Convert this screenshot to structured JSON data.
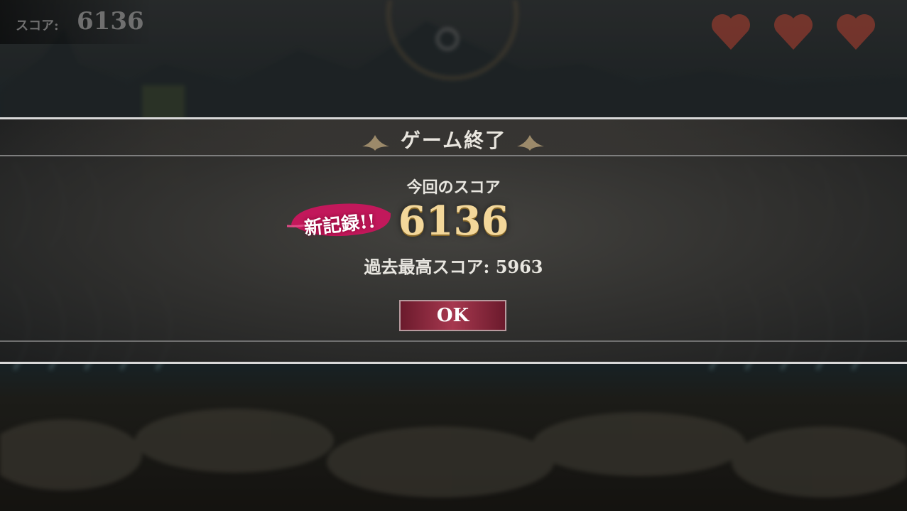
{
  "hud": {
    "score_label": "スコア:",
    "score_value": "6136",
    "lives": 3
  },
  "dialog": {
    "title": "ゲーム終了",
    "current_score_label": "今回のスコア",
    "current_score": "6136",
    "new_record_badge": "新記録!!",
    "best_score_text": "過去最高スコア: 5963",
    "ok_button": "OK"
  },
  "colors": {
    "score_gold": "#f3d79a",
    "badge_magenta": "#c2185b",
    "ok_button": "#a7384f"
  }
}
